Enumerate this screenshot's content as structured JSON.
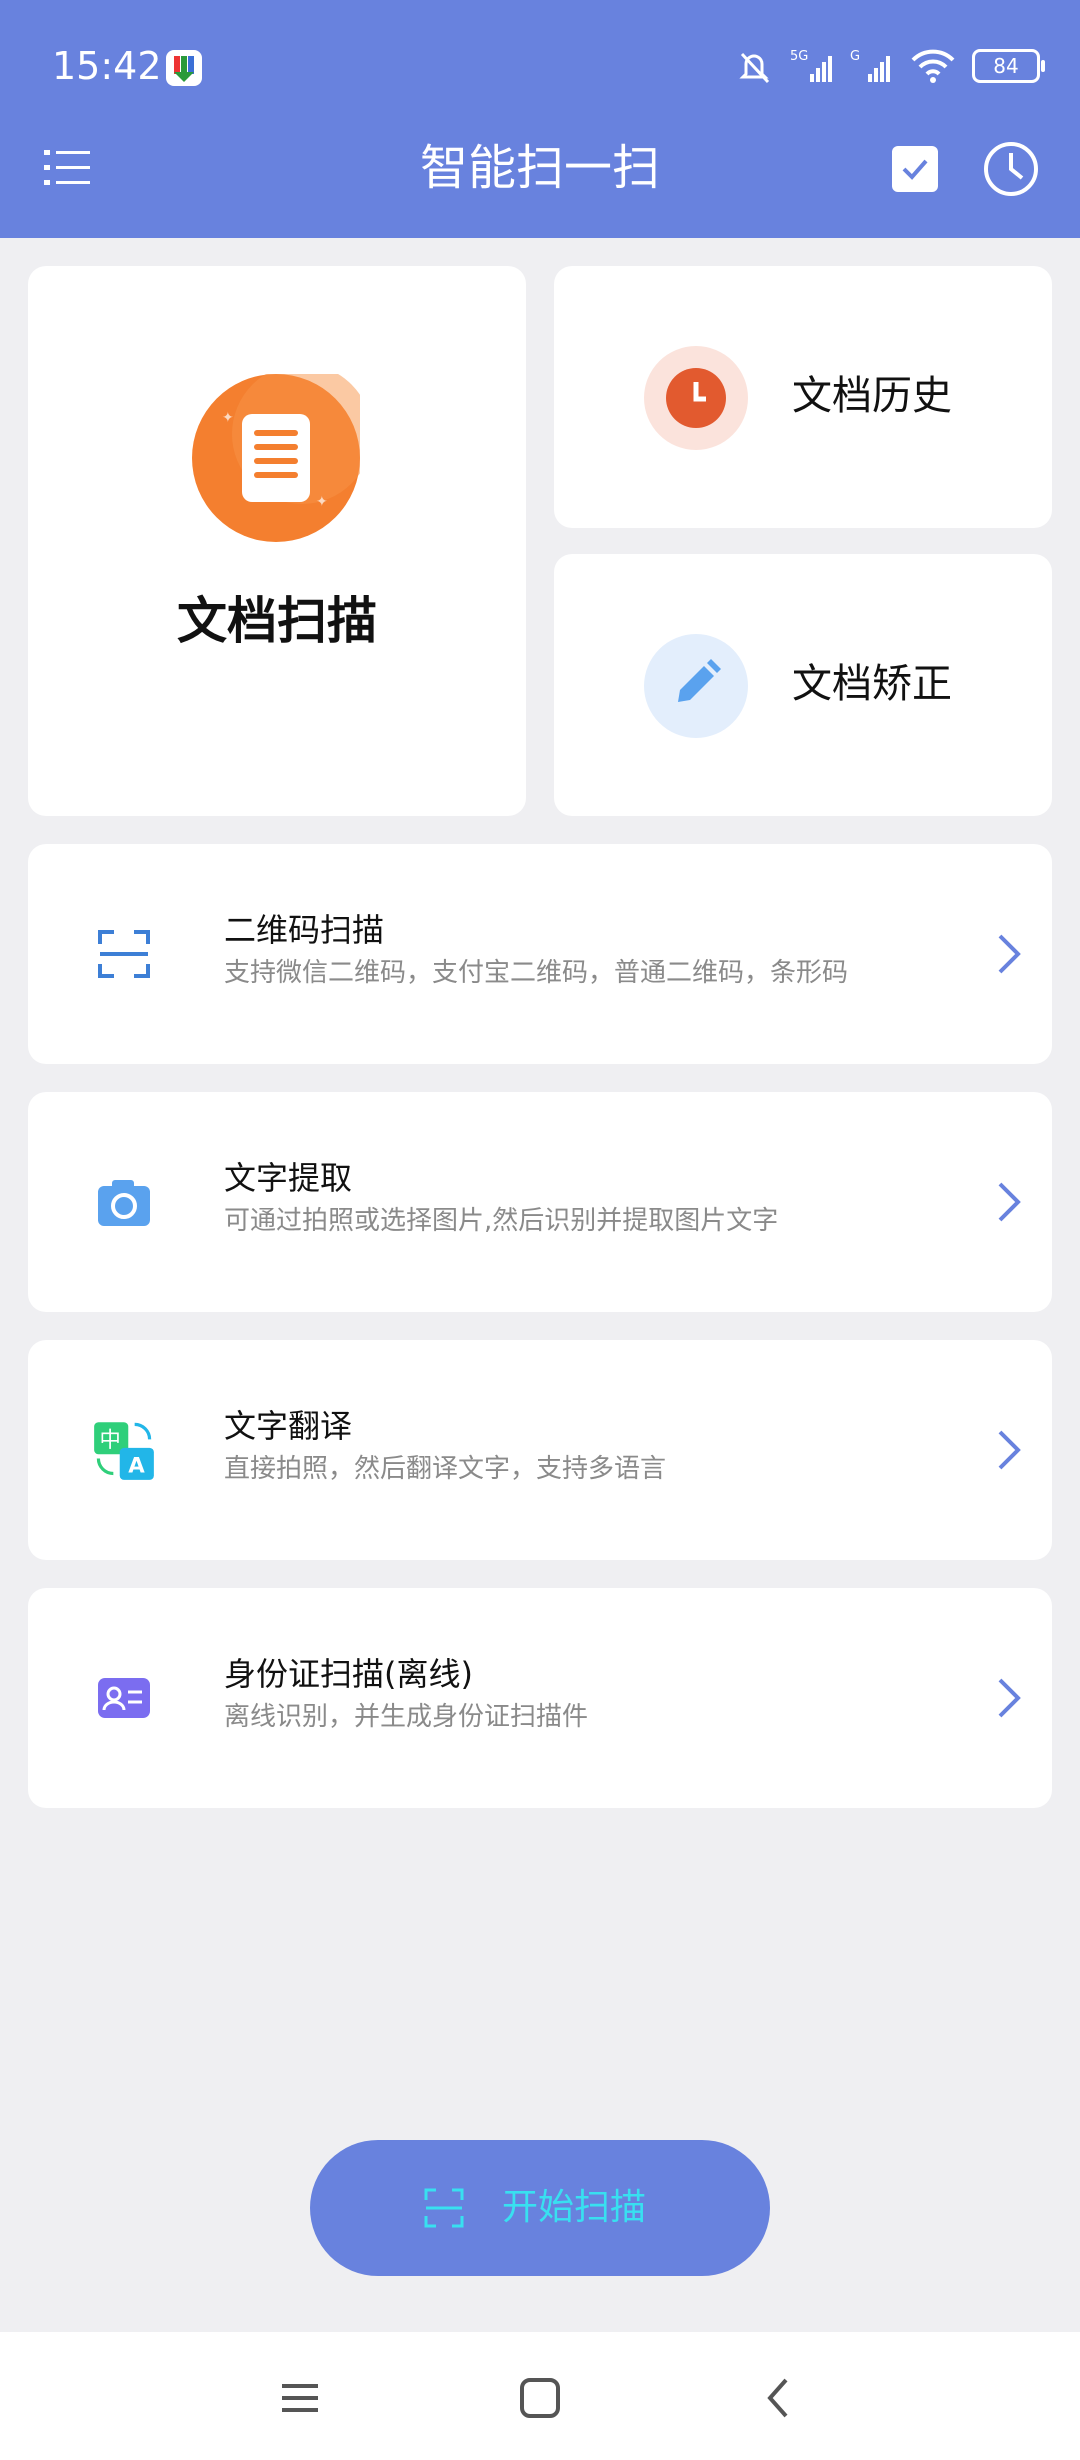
{
  "status_bar": {
    "time": "15:42",
    "battery": "84",
    "icons": [
      "app-notification-icon",
      "mute-bell-icon",
      "signal-5g-icon",
      "signal-g-icon",
      "wifi-icon",
      "battery-icon"
    ]
  },
  "header": {
    "title": "智能扫一扫",
    "icons": [
      "menu-list-icon",
      "checkbox-icon",
      "history-clock-icon"
    ]
  },
  "feature_cards": {
    "doc_scan": {
      "label": "文档扫描",
      "icon": "document-icon"
    },
    "doc_history": {
      "label": "文档历史",
      "icon": "clock-icon"
    },
    "doc_correct": {
      "label": "文档矫正",
      "icon": "pencil-icon"
    }
  },
  "list_items": [
    {
      "title": "二维码扫描",
      "subtitle": "支持微信二维码，支付宝二维码，普通二维码，条形码",
      "icon": "qr-scan-icon"
    },
    {
      "title": "文字提取",
      "subtitle": "可通过拍照或选择图片,然后识别并提取图片文字",
      "icon": "camera-icon"
    },
    {
      "title": "文字翻译",
      "subtitle": "直接拍照，然后翻译文字，支持多语言",
      "icon": "translate-icon"
    },
    {
      "title": "身份证扫描(离线)",
      "subtitle": "离线识别，并生成身份证扫描件",
      "icon": "id-card-icon"
    }
  ],
  "start_button": {
    "label": "开始扫描",
    "icon": "scan-frame-icon"
  },
  "nav_bar": {
    "icons": [
      "recent-apps-icon",
      "home-icon",
      "back-icon"
    ]
  },
  "colors": {
    "primary": "#6882de",
    "accent_text": "#38e0f0",
    "orange": "#f47f2f",
    "blue": "#5aa2ee"
  }
}
